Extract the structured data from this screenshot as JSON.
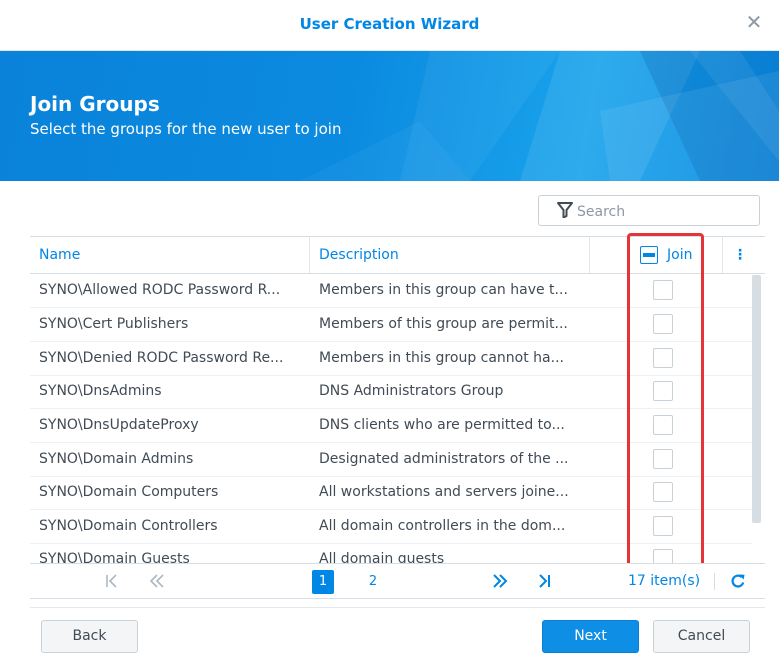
{
  "dialog": {
    "title": "User Creation Wizard"
  },
  "banner": {
    "heading": "Join Groups",
    "subheading": "Select the groups for the new user to join"
  },
  "search": {
    "placeholder": "Search"
  },
  "grid": {
    "columns": {
      "name": "Name",
      "description": "Description",
      "join": "Join"
    },
    "rows": [
      {
        "name": "SYNO\\Allowed RODC Password R...",
        "description": "Members in this group can have t...",
        "join": false
      },
      {
        "name": "SYNO\\Cert Publishers",
        "description": "Members of this group are permit...",
        "join": false
      },
      {
        "name": "SYNO\\Denied RODC Password Re...",
        "description": "Members in this group cannot ha...",
        "join": false
      },
      {
        "name": "SYNO\\DnsAdmins",
        "description": "DNS Administrators Group",
        "join": false
      },
      {
        "name": "SYNO\\DnsUpdateProxy",
        "description": "DNS clients who are permitted to...",
        "join": false
      },
      {
        "name": "SYNO\\Domain Admins",
        "description": "Designated administrators of the ...",
        "join": false
      },
      {
        "name": "SYNO\\Domain Computers",
        "description": "All workstations and servers joine...",
        "join": false
      },
      {
        "name": "SYNO\\Domain Controllers",
        "description": "All domain controllers in the dom...",
        "join": false
      },
      {
        "name": "SYNO\\Domain Guests",
        "description": "All domain guests",
        "join": false
      }
    ]
  },
  "pager": {
    "first": "|<",
    "prev": "<<",
    "pages": [
      "1",
      "2"
    ],
    "current_page": "1",
    "next": ">>",
    "last": ">|",
    "count": "17 item(s)"
  },
  "buttons": {
    "back": "Back",
    "next": "Next",
    "cancel": "Cancel"
  },
  "colors": {
    "accent": "#0086e5",
    "highlight": "#e5333a"
  }
}
